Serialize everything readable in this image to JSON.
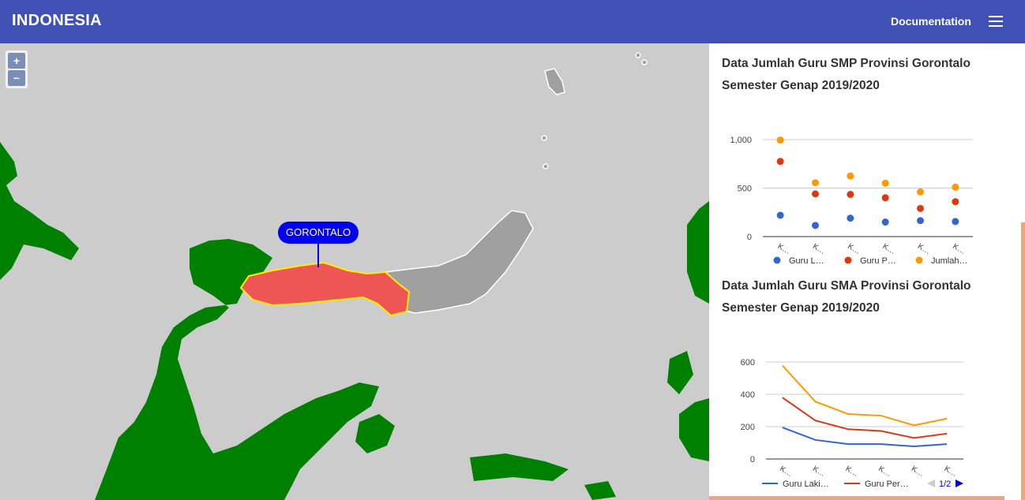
{
  "header": {
    "title": "INDONESIA",
    "doc_label": "Documentation",
    "menu_icon": "hamburger-menu-icon"
  },
  "map": {
    "zoom_in": "+",
    "zoom_out": "−",
    "selected_region": "GORONTALO",
    "colors": {
      "land": "#008000",
      "water": "#cccccc",
      "selected": "#ee5555",
      "selected_border": "#ffee00",
      "neighbor": "#a0a0a0"
    }
  },
  "chart_data": [
    {
      "type": "scatter",
      "title": "Data Jumlah Guru SMP Provinsi Gorontalo Semester Genap 2019/2020",
      "categories": [
        "K…",
        "K…",
        "K…",
        "K…",
        "K…",
        "K…"
      ],
      "series": [
        {
          "name": "Guru L…",
          "color": "#3366cc",
          "values": [
            220,
            115,
            190,
            150,
            165,
            155
          ]
        },
        {
          "name": "Guru P…",
          "color": "#dc3912",
          "values": [
            775,
            440,
            435,
            400,
            290,
            360
          ]
        },
        {
          "name": "Jumlah…",
          "color": "#ff9900",
          "values": [
            995,
            555,
            625,
            550,
            460,
            510
          ]
        }
      ],
      "yticks": [
        "1,000",
        "500",
        "0"
      ],
      "ylim": [
        0,
        1000
      ]
    },
    {
      "type": "line",
      "title": "Data Jumlah Guru SMA Provinsi Gorontalo Semester Genap 2019/2020",
      "categories": [
        "K…",
        "K…",
        "K…",
        "K…",
        "K…",
        "K…"
      ],
      "series": [
        {
          "name": "Guru Laki…",
          "color": "#3366cc",
          "values": [
            195,
            118,
            92,
            92,
            78,
            92
          ]
        },
        {
          "name": "Guru Per…",
          "color": "#dc3912",
          "values": [
            380,
            238,
            184,
            173,
            130,
            157
          ]
        },
        {
          "name": "",
          "color": "#ff9900",
          "values": [
            578,
            355,
            278,
            268,
            208,
            250
          ]
        }
      ],
      "yticks": [
        "600",
        "400",
        "200",
        "0"
      ],
      "ylim": [
        0,
        600
      ],
      "legend_page": "1/2"
    }
  ]
}
